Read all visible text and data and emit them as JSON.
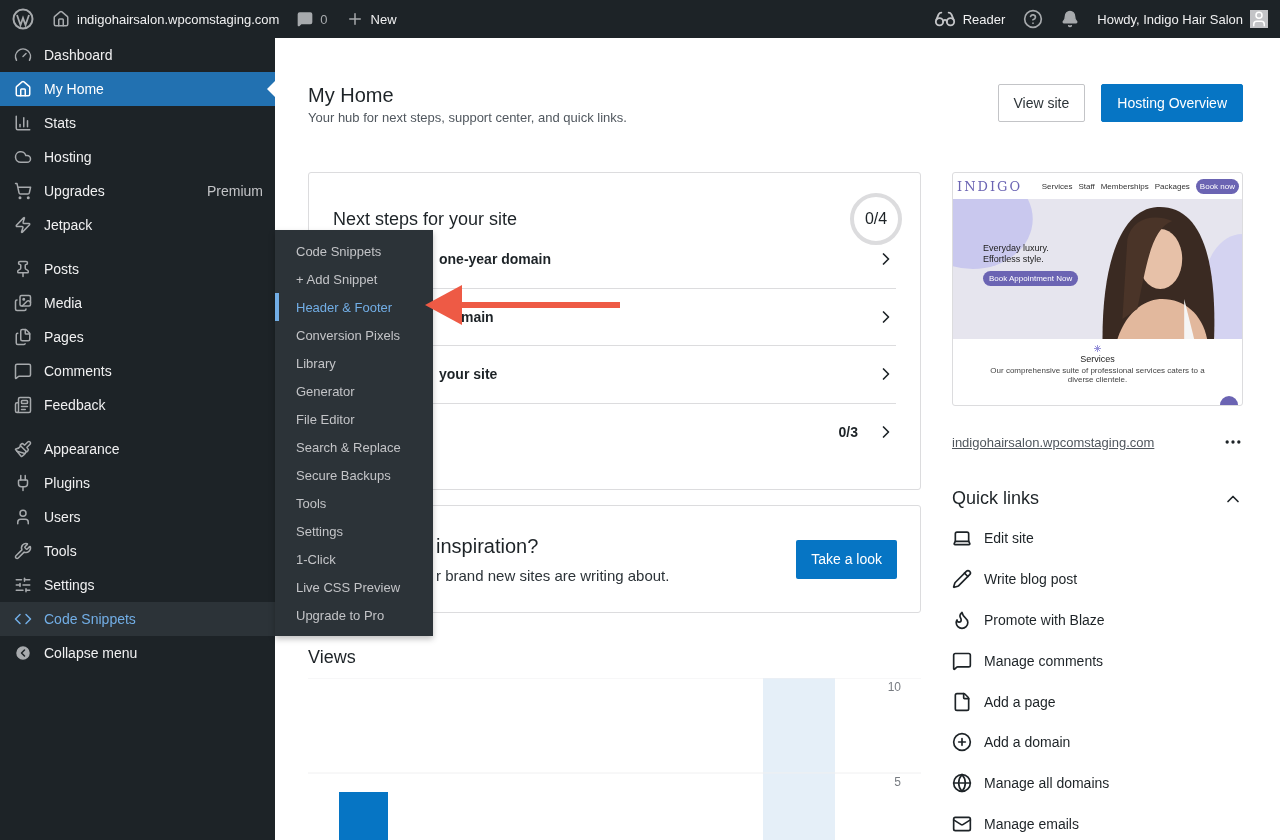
{
  "admin_bar": {
    "site": "indigohairsalon.wpcomstaging.com",
    "comments": "0",
    "new": "New",
    "reader": "Reader",
    "greeting": "Howdy, Indigo Hair Salon"
  },
  "sidebar": {
    "groups": [
      [
        {
          "label": "Dashboard",
          "selected": false,
          "highlighted": false
        },
        {
          "label": "My Home",
          "selected": true,
          "highlighted": false
        },
        {
          "label": "Stats",
          "selected": false,
          "highlighted": false
        },
        {
          "label": "Hosting",
          "selected": false,
          "highlighted": false
        },
        {
          "label": "Upgrades",
          "badge": "Premium",
          "selected": false,
          "highlighted": false
        },
        {
          "label": "Jetpack",
          "selected": false,
          "highlighted": false
        }
      ],
      [
        {
          "label": "Posts",
          "selected": false,
          "highlighted": false
        },
        {
          "label": "Media",
          "selected": false,
          "highlighted": false
        },
        {
          "label": "Pages",
          "selected": false,
          "highlighted": false
        },
        {
          "label": "Comments",
          "selected": false,
          "highlighted": false
        },
        {
          "label": "Feedback",
          "selected": false,
          "highlighted": false
        }
      ],
      [
        {
          "label": "Appearance",
          "selected": false,
          "highlighted": false
        },
        {
          "label": "Plugins",
          "selected": false,
          "highlighted": false
        },
        {
          "label": "Users",
          "selected": false,
          "highlighted": false
        },
        {
          "label": "Tools",
          "selected": false,
          "highlighted": false
        },
        {
          "label": "Settings",
          "selected": false,
          "highlighted": false
        },
        {
          "label": "Code Snippets",
          "selected": false,
          "highlighted": true
        }
      ]
    ],
    "collapse": "Collapse menu"
  },
  "flyout": [
    {
      "label": "Code Snippets",
      "selected": false
    },
    {
      "label": "+ Add Snippet",
      "selected": false
    },
    {
      "label": "Header & Footer",
      "selected": true
    },
    {
      "label": "Conversion Pixels",
      "selected": false
    },
    {
      "label": "Library",
      "selected": false
    },
    {
      "label": "Generator",
      "selected": false
    },
    {
      "label": "File Editor",
      "selected": false
    },
    {
      "label": "Search & Replace",
      "selected": false
    },
    {
      "label": "Secure Backups",
      "selected": false
    },
    {
      "label": "Tools",
      "selected": false
    },
    {
      "label": "Settings",
      "selected": false
    },
    {
      "label": "1-Click",
      "selected": false
    },
    {
      "label": "Live CSS Preview",
      "selected": false
    },
    {
      "label": "Upgrade to Pro",
      "selected": false
    }
  ],
  "page": {
    "title": "My Home",
    "subtitle": "Your hub for next steps, support center, and quick links.",
    "buttons": [
      {
        "label": "View site",
        "kind": "secondary"
      },
      {
        "label": "Hosting Overview",
        "kind": "primary"
      }
    ]
  },
  "next_steps": {
    "title": "Next steps for your site",
    "progress": "0/4",
    "rows": [
      {
        "text": "one-year domain"
      },
      {
        "text": "main"
      },
      {
        "text": "your site"
      },
      {
        "count": "0/3"
      }
    ]
  },
  "inspiration": {
    "title": "inspiration?",
    "text": "r brand new sites are writing about.",
    "button": "Take a look"
  },
  "views": {
    "title": "Views",
    "chart_data": {
      "type": "bar",
      "values": [
        4,
        0,
        0,
        0,
        0,
        0,
        0,
        0
      ],
      "ylim": [
        0,
        10
      ],
      "yticks": [
        5,
        10
      ]
    }
  },
  "preview": {
    "logo": "INDIGO",
    "nav": [
      "Services",
      "Staff",
      "Memberships",
      "Packages"
    ],
    "cta": "Book now",
    "headline": "Everyday luxury. Effortless style.",
    "hero_button": "Book Appointment Now",
    "section_title": "Services",
    "section_text": "Our comprehensive suite of professional services caters to a diverse clientele.",
    "url": "indigohairsalon.wpcomstaging.com"
  },
  "quick_links": {
    "title": "Quick links",
    "expanded": true,
    "items": [
      "Edit site",
      "Write blog post",
      "Promote with Blaze",
      "Manage comments",
      "Add a page",
      "Add a domain",
      "Manage all domains",
      "Manage emails"
    ]
  }
}
